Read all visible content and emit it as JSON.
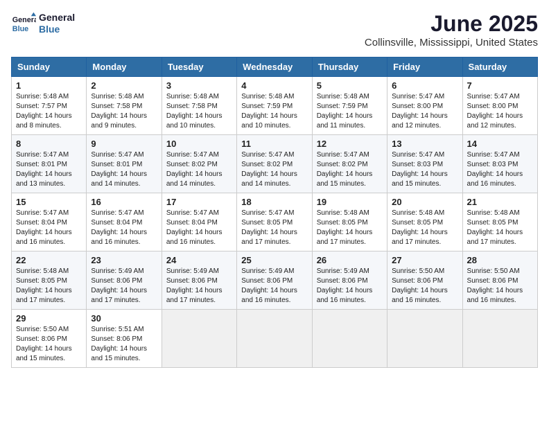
{
  "header": {
    "logo_line1": "General",
    "logo_line2": "Blue",
    "month": "June 2025",
    "location": "Collinsville, Mississippi, United States"
  },
  "weekdays": [
    "Sunday",
    "Monday",
    "Tuesday",
    "Wednesday",
    "Thursday",
    "Friday",
    "Saturday"
  ],
  "weeks": [
    [
      {
        "day": "1",
        "sunrise": "5:48 AM",
        "sunset": "7:57 PM",
        "daylight": "14 hours and 8 minutes."
      },
      {
        "day": "2",
        "sunrise": "5:48 AM",
        "sunset": "7:58 PM",
        "daylight": "14 hours and 9 minutes."
      },
      {
        "day": "3",
        "sunrise": "5:48 AM",
        "sunset": "7:58 PM",
        "daylight": "14 hours and 10 minutes."
      },
      {
        "day": "4",
        "sunrise": "5:48 AM",
        "sunset": "7:59 PM",
        "daylight": "14 hours and 10 minutes."
      },
      {
        "day": "5",
        "sunrise": "5:48 AM",
        "sunset": "7:59 PM",
        "daylight": "14 hours and 11 minutes."
      },
      {
        "day": "6",
        "sunrise": "5:47 AM",
        "sunset": "8:00 PM",
        "daylight": "14 hours and 12 minutes."
      },
      {
        "day": "7",
        "sunrise": "5:47 AM",
        "sunset": "8:00 PM",
        "daylight": "14 hours and 12 minutes."
      }
    ],
    [
      {
        "day": "8",
        "sunrise": "5:47 AM",
        "sunset": "8:01 PM",
        "daylight": "14 hours and 13 minutes."
      },
      {
        "day": "9",
        "sunrise": "5:47 AM",
        "sunset": "8:01 PM",
        "daylight": "14 hours and 14 minutes."
      },
      {
        "day": "10",
        "sunrise": "5:47 AM",
        "sunset": "8:02 PM",
        "daylight": "14 hours and 14 minutes."
      },
      {
        "day": "11",
        "sunrise": "5:47 AM",
        "sunset": "8:02 PM",
        "daylight": "14 hours and 14 minutes."
      },
      {
        "day": "12",
        "sunrise": "5:47 AM",
        "sunset": "8:02 PM",
        "daylight": "14 hours and 15 minutes."
      },
      {
        "day": "13",
        "sunrise": "5:47 AM",
        "sunset": "8:03 PM",
        "daylight": "14 hours and 15 minutes."
      },
      {
        "day": "14",
        "sunrise": "5:47 AM",
        "sunset": "8:03 PM",
        "daylight": "14 hours and 16 minutes."
      }
    ],
    [
      {
        "day": "15",
        "sunrise": "5:47 AM",
        "sunset": "8:04 PM",
        "daylight": "14 hours and 16 minutes."
      },
      {
        "day": "16",
        "sunrise": "5:47 AM",
        "sunset": "8:04 PM",
        "daylight": "14 hours and 16 minutes."
      },
      {
        "day": "17",
        "sunrise": "5:47 AM",
        "sunset": "8:04 PM",
        "daylight": "14 hours and 16 minutes."
      },
      {
        "day": "18",
        "sunrise": "5:47 AM",
        "sunset": "8:05 PM",
        "daylight": "14 hours and 17 minutes."
      },
      {
        "day": "19",
        "sunrise": "5:48 AM",
        "sunset": "8:05 PM",
        "daylight": "14 hours and 17 minutes."
      },
      {
        "day": "20",
        "sunrise": "5:48 AM",
        "sunset": "8:05 PM",
        "daylight": "14 hours and 17 minutes."
      },
      {
        "day": "21",
        "sunrise": "5:48 AM",
        "sunset": "8:05 PM",
        "daylight": "14 hours and 17 minutes."
      }
    ],
    [
      {
        "day": "22",
        "sunrise": "5:48 AM",
        "sunset": "8:05 PM",
        "daylight": "14 hours and 17 minutes."
      },
      {
        "day": "23",
        "sunrise": "5:49 AM",
        "sunset": "8:06 PM",
        "daylight": "14 hours and 17 minutes."
      },
      {
        "day": "24",
        "sunrise": "5:49 AM",
        "sunset": "8:06 PM",
        "daylight": "14 hours and 17 minutes."
      },
      {
        "day": "25",
        "sunrise": "5:49 AM",
        "sunset": "8:06 PM",
        "daylight": "14 hours and 16 minutes."
      },
      {
        "day": "26",
        "sunrise": "5:49 AM",
        "sunset": "8:06 PM",
        "daylight": "14 hours and 16 minutes."
      },
      {
        "day": "27",
        "sunrise": "5:50 AM",
        "sunset": "8:06 PM",
        "daylight": "14 hours and 16 minutes."
      },
      {
        "day": "28",
        "sunrise": "5:50 AM",
        "sunset": "8:06 PM",
        "daylight": "14 hours and 16 minutes."
      }
    ],
    [
      {
        "day": "29",
        "sunrise": "5:50 AM",
        "sunset": "8:06 PM",
        "daylight": "14 hours and 15 minutes."
      },
      {
        "day": "30",
        "sunrise": "5:51 AM",
        "sunset": "8:06 PM",
        "daylight": "14 hours and 15 minutes."
      },
      null,
      null,
      null,
      null,
      null
    ]
  ]
}
